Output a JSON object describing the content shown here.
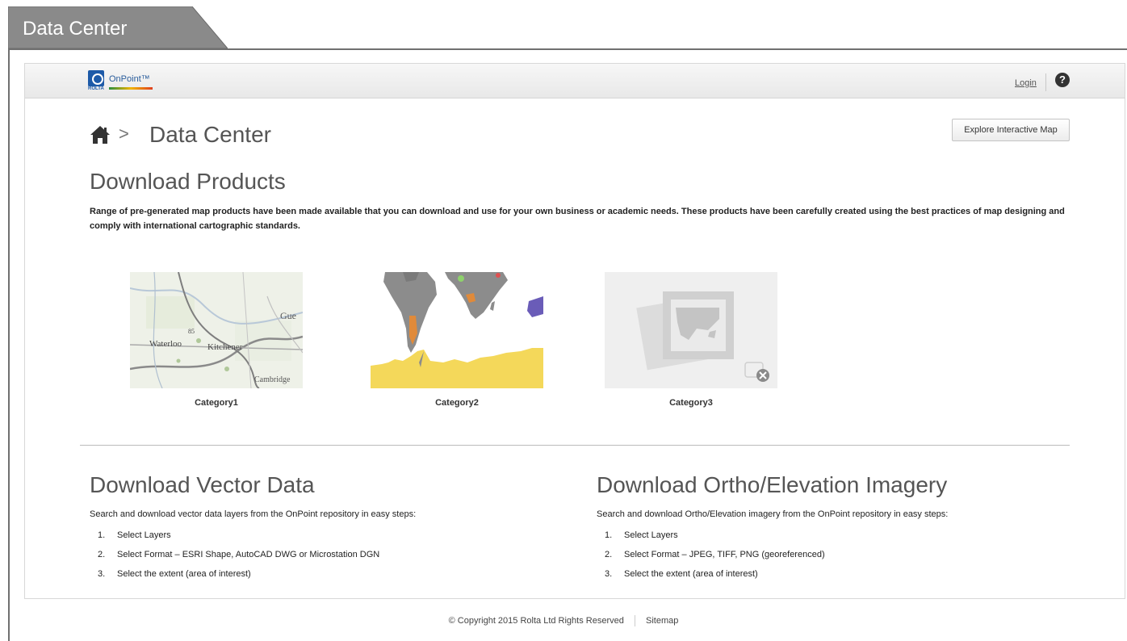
{
  "frame": {
    "tab_label": "Data Center"
  },
  "header": {
    "logo_text": "OnPoint™",
    "logo_brand": "ROLTA",
    "login_label": "Login",
    "help_label": "?"
  },
  "breadcrumb": {
    "separator": ">",
    "current": "Data Center"
  },
  "explore_button": "Explore Interactive Map",
  "products": {
    "title": "Download Products",
    "description": "Range of pre-generated map products have been made available that you can download and use for your own business or academic needs. These products have been carefully created using the best practices of map designing and comply with international cartographic standards.",
    "categories": [
      {
        "label": "Category1",
        "map_labels": [
          "Gue",
          "Waterloo",
          "Kitchener",
          "Cambridge",
          "85"
        ]
      },
      {
        "label": "Category2"
      },
      {
        "label": "Category3"
      }
    ]
  },
  "vector": {
    "title": "Download Vector Data",
    "intro": "Search and download vector data layers from the OnPoint repository in easy steps:",
    "steps": [
      {
        "num": "1.",
        "text": "Select Layers"
      },
      {
        "num": "2.",
        "text": "Select Format – ESRI Shape, AutoCAD DWG or Microstation DGN"
      },
      {
        "num": "3.",
        "text": "Select the extent (area of interest)"
      }
    ]
  },
  "ortho": {
    "title": "Download Ortho/Elevation Imagery",
    "intro": "Search and download Ortho/Elevation imagery from the OnPoint repository in easy steps:",
    "steps": [
      {
        "num": "1.",
        "text": "Select Layers"
      },
      {
        "num": "2.",
        "text": "Select Format – JPEG, TIFF, PNG (georeferenced)"
      },
      {
        "num": "3.",
        "text": "Select the extent (area of interest)"
      }
    ]
  },
  "footer": {
    "copyright": "© Copyright 2015 Rolta Ltd Rights Reserved",
    "sitemap": "Sitemap"
  },
  "colors": {
    "frame_gray": "#8a8a8a",
    "frame_line": "#707070",
    "map_yellow": "#f4d85a",
    "map_gray": "#8c8c8c",
    "map_orange": "#e08a3a",
    "map_purple": "#6a5cb8"
  }
}
